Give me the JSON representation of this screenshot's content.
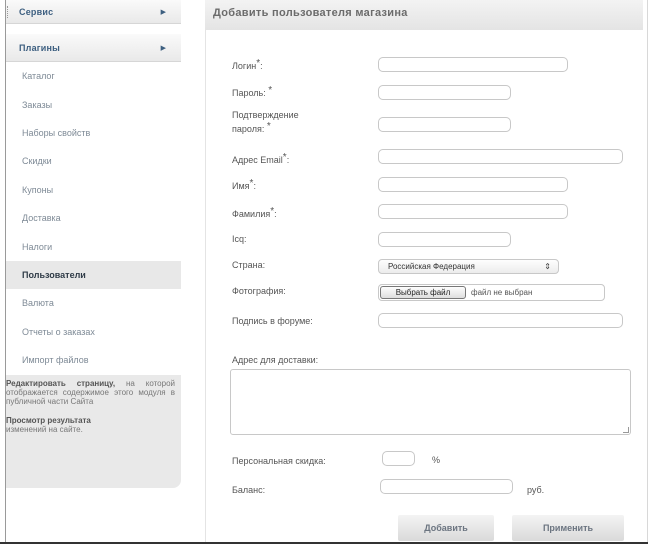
{
  "sidebar": {
    "menus": [
      {
        "label": "Сервис"
      },
      {
        "label": "Плагины"
      }
    ],
    "items": [
      {
        "label": "Каталог"
      },
      {
        "label": "Заказы"
      },
      {
        "label": "Наборы свойств"
      },
      {
        "label": "Скидки"
      },
      {
        "label": "Купоны"
      },
      {
        "label": "Доставка"
      },
      {
        "label": "Налоги"
      },
      {
        "label": "Пользователи"
      },
      {
        "label": "Валюта"
      },
      {
        "label": "Отчеты о заказах"
      },
      {
        "label": "Импорт файлов"
      }
    ],
    "info": {
      "edit_strong": "Редактировать страницу,",
      "edit_text": "на которой отображается содержимое этого модуля в публичной части Сайта",
      "preview_strong": "Просмотр результата",
      "preview_text": "изменений на сайте."
    }
  },
  "form": {
    "title": "Добавить пользователя магазина",
    "login_label": "Логин",
    "password_label": "Пароль:",
    "confirm_label_1": "Подтверждение",
    "confirm_label_2": "пароля:",
    "email_label": "Адрес Email",
    "name_label": "Имя",
    "surname_label": "Фамилия",
    "icq_label": "Icq:",
    "country_label": "Страна:",
    "country_value": "Российская Федерация",
    "photo_label": "Фотография:",
    "file_button": "Выбрать файл",
    "file_status": "файл не выбран",
    "signature_label": "Подпись в форуме:",
    "address_label": "Адрес для доставки:",
    "discount_label": "Персональная скидка:",
    "discount_unit": "%",
    "balance_label": "Баланс:",
    "balance_unit": "руб.",
    "required_mark": "*",
    "add_button": "Добавить",
    "apply_button": "Применить"
  }
}
